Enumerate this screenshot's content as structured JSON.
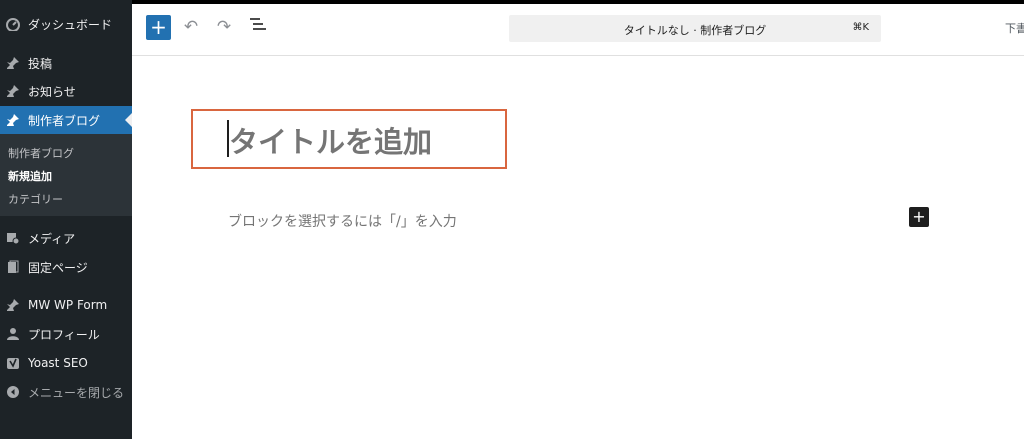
{
  "sidebar": {
    "dashboard": {
      "label": "ダッシュボード",
      "icon": "dashboard-icon"
    },
    "posts": {
      "label": "投稿",
      "icon": "pin-icon"
    },
    "news": {
      "label": "お知らせ",
      "icon": "pin-icon"
    },
    "creator_blog": {
      "label": "制作者ブログ",
      "icon": "pin-icon",
      "submenu": [
        "制作者ブログ",
        "新規追加",
        "カテゴリー"
      ]
    },
    "media": {
      "label": "メディア",
      "icon": "media-icon"
    },
    "pages": {
      "label": "固定ページ",
      "icon": "page-icon"
    },
    "mw_wp_form": {
      "label": "MW WP Form",
      "icon": "pin-icon"
    },
    "profile": {
      "label": "プロフィール",
      "icon": "user-icon"
    },
    "yoast": {
      "label": "Yoast SEO",
      "icon": "yoast-icon"
    },
    "collapse": {
      "label": "メニューを閉じる",
      "icon": "collapse-icon"
    }
  },
  "toolbar": {
    "add_label": "+",
    "undo_glyph": "↶",
    "redo_glyph": "↷",
    "list_glyph": "☰",
    "command_title": "タイトルなし · 制作者ブログ",
    "command_shortcut": "⌘K",
    "draft_label": "下書"
  },
  "editor": {
    "title_placeholder": "タイトルを追加",
    "block_placeholder": "ブロックを選択するには「/」を入力",
    "inserter_label": "+"
  },
  "colors": {
    "sidebar_bg": "#1d2327",
    "active_bg": "#2271b1",
    "highlight_border": "#d9663f"
  }
}
